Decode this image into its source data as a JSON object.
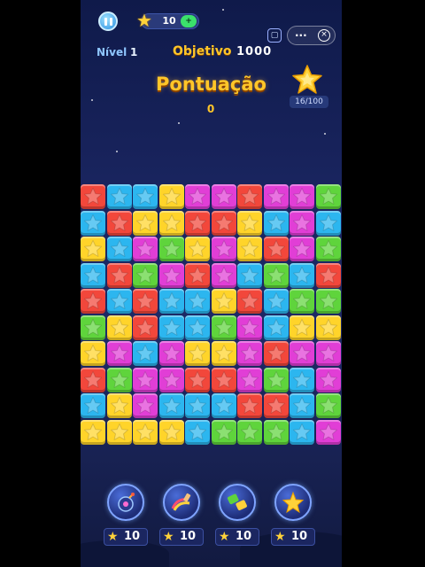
{
  "header": {
    "coins": "10",
    "coin_plus": "+",
    "menu_dots": "···",
    "close_symbol": "×",
    "level_label": "Nível",
    "level_value": "1",
    "objective_label": "Objetivo",
    "objective_value": "1000",
    "score_label": "Pontuação",
    "score_value": "0",
    "star_progress": "16/100"
  },
  "board": {
    "rows": [
      [
        "R",
        "B",
        "B",
        "Y",
        "M",
        "M",
        "R",
        "M",
        "M",
        "G"
      ],
      [
        "B",
        "R",
        "Y",
        "Y",
        "R",
        "R",
        "Y",
        "B",
        "M",
        "B"
      ],
      [
        "Y",
        "B",
        "M",
        "G",
        "Y",
        "M",
        "Y",
        "R",
        "M",
        "G"
      ],
      [
        "B",
        "R",
        "G",
        "M",
        "R",
        "M",
        "B",
        "G",
        "B",
        "R"
      ],
      [
        "R",
        "B",
        "R",
        "B",
        "B",
        "Y",
        "R",
        "B",
        "G",
        "G"
      ],
      [
        "G",
        "Y",
        "R",
        "B",
        "B",
        "G",
        "M",
        "B",
        "Y",
        "Y"
      ],
      [
        "Y",
        "M",
        "B",
        "M",
        "Y",
        "Y",
        "M",
        "R",
        "M",
        "M"
      ],
      [
        "R",
        "G",
        "M",
        "M",
        "R",
        "R",
        "M",
        "G",
        "B",
        "M"
      ],
      [
        "B",
        "Y",
        "M",
        "B",
        "B",
        "B",
        "R",
        "R",
        "B",
        "G"
      ],
      [
        "Y",
        "Y",
        "Y",
        "Y",
        "B",
        "G",
        "G",
        "G",
        "B",
        "M"
      ]
    ],
    "colors": {
      "R": "#f2473b",
      "B": "#2cb6ef",
      "Y": "#ffd42a",
      "M": "#e13ed6",
      "G": "#5fd43c"
    }
  },
  "boosters": [
    {
      "name": "bomb",
      "count": "10",
      "icon": "bomb-icon"
    },
    {
      "name": "paint",
      "count": "10",
      "icon": "paintbrush-icon"
    },
    {
      "name": "swap",
      "count": "10",
      "icon": "swap-icon"
    },
    {
      "name": "star",
      "count": "10",
      "icon": "star-icon"
    }
  ],
  "accent": {
    "gold": "#ffc629",
    "background": "#1a2560"
  }
}
